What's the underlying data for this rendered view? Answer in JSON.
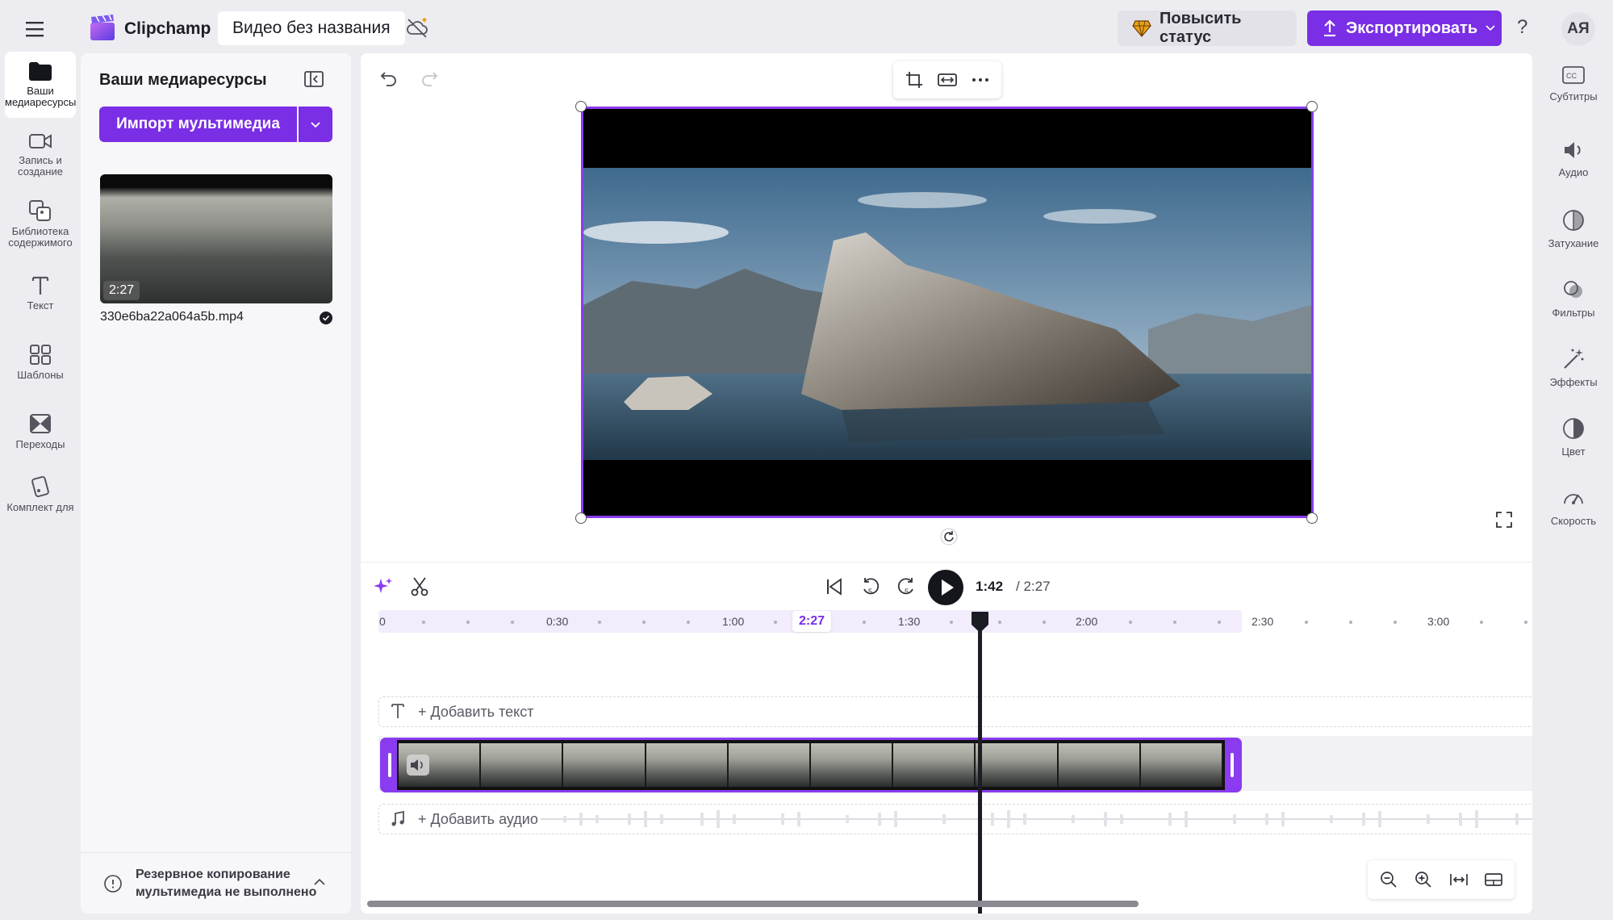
{
  "topbar": {
    "brand": "Clipchamp",
    "project_title": "Видео без названия",
    "upgrade_label": "Повысить статус",
    "export_label": "Экспортировать",
    "help_label": "?",
    "avatar_initials": "АЯ"
  },
  "left_rail": {
    "items": [
      {
        "label": "Ваши медиаресурсы",
        "icon": "folder-icon",
        "active": true
      },
      {
        "label": "Запись и создание",
        "icon": "camera-icon"
      },
      {
        "label": "Библиотека содержимого",
        "icon": "library-icon"
      },
      {
        "label": "Текст",
        "icon": "text-icon"
      },
      {
        "label": "Шаблоны",
        "icon": "templates-icon"
      },
      {
        "label": "Переходы",
        "icon": "transitions-icon"
      },
      {
        "label": "Комплект для",
        "icon": "brand-kit-icon"
      }
    ]
  },
  "media_panel": {
    "title": "Ваши медиаресурсы",
    "import_label": "Импорт мультимедиа",
    "asset": {
      "duration": "2:27",
      "filename": "330e6ba22a064a5b.mp4"
    },
    "backup_message": "Резервное копирование мультимедиа не выполнено"
  },
  "player": {
    "current_time": "1:42",
    "total_time": "/ 2:27"
  },
  "timeline": {
    "ruler_labels": [
      "0",
      "0:30",
      "1:00",
      "1:30",
      "2:00",
      "2:30",
      "3:00"
    ],
    "end_marker": "2:27",
    "add_text_label": "+ Добавить текст",
    "add_audio_label": "+ Добавить аудио"
  },
  "right_rail": {
    "items": [
      {
        "label": "Субтитры",
        "icon": "captions-icon"
      },
      {
        "label": "Аудио",
        "icon": "speaker-icon"
      },
      {
        "label": "Затухание",
        "icon": "fade-icon"
      },
      {
        "label": "Фильтры",
        "icon": "filters-icon"
      },
      {
        "label": "Эффекты",
        "icon": "effects-icon"
      },
      {
        "label": "Цвет",
        "icon": "color-icon"
      },
      {
        "label": "Скорость",
        "icon": "speed-icon"
      }
    ]
  },
  "colors": {
    "accent": "#7a2ee5",
    "selection": "#8b3cf0",
    "background": "#ededf1"
  }
}
